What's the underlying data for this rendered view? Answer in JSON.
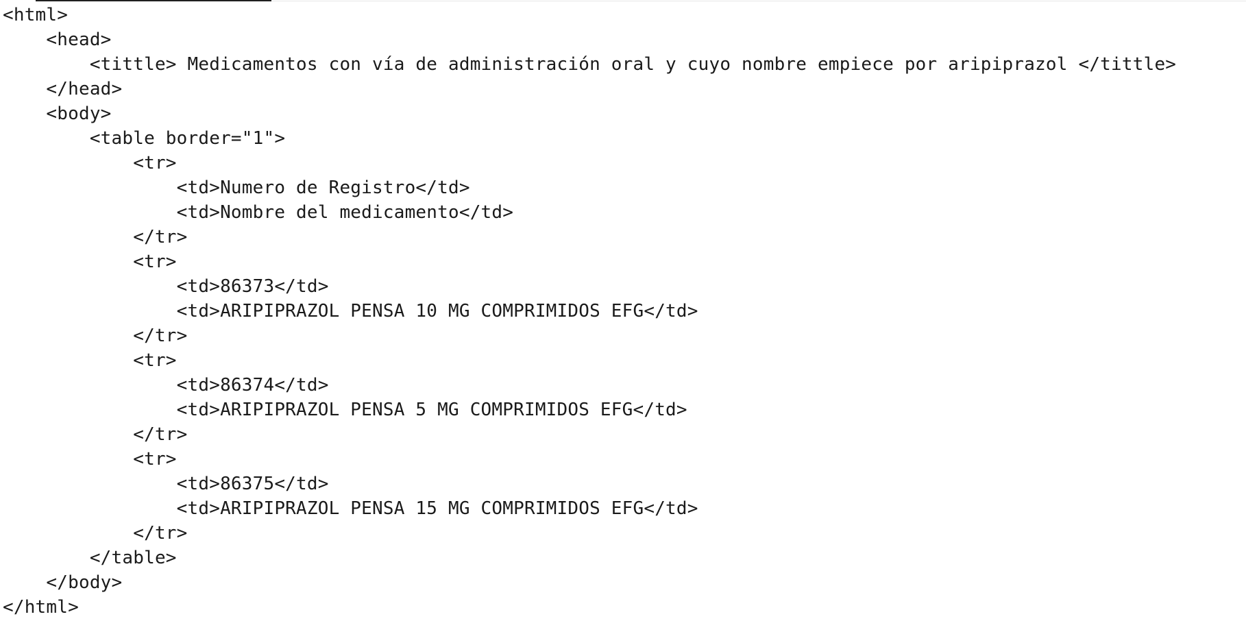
{
  "editor": {
    "lines": [
      "<html>",
      "    <head>",
      "        <tittle> Medicamentos con vía de administración oral y cuyo nombre empiece por aripiprazol </tittle>",
      "    </head>",
      "    <body>",
      "        <table border=\"1\">",
      "            <tr>",
      "                <td>Numero de Registro</td>",
      "                <td>Nombre del medicamento</td>",
      "            </tr>",
      "            <tr>",
      "                <td>86373</td>",
      "                <td>ARIPIPRAZOL PENSA 10 MG COMPRIMIDOS EFG</td>",
      "            </tr>",
      "            <tr>",
      "                <td>86374</td>",
      "                <td>ARIPIPRAZOL PENSA 5 MG COMPRIMIDOS EFG</td>",
      "            </tr>",
      "            <tr>",
      "                <td>86375</td>",
      "                <td>ARIPIPRAZOL PENSA 15 MG COMPRIMIDOS EFG</td>",
      "            </tr>",
      "        </table>",
      "    </body>",
      "</html>"
    ]
  }
}
